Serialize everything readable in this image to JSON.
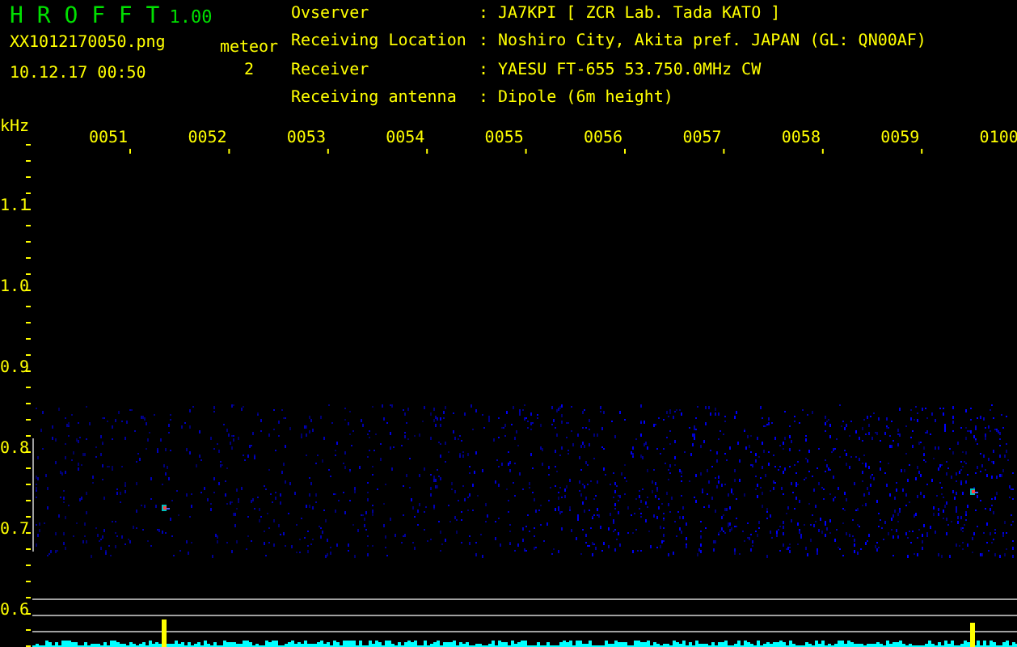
{
  "header": {
    "title": "H R O F F T",
    "version": "1.00",
    "filename": "XX1012170050.png",
    "datetime": "10.12.17 00:50",
    "meteor_label": "meteor",
    "meteor_count": "2"
  },
  "info": [
    {
      "label": "Ovserver",
      "value": ": JA7KPI [ ZCR Lab. Tada KATO ]"
    },
    {
      "label": "Receiving Location",
      "value": ": Noshiro City, Akita pref. JAPAN (GL: QN00AF)"
    },
    {
      "label": "Receiver",
      "value": ": YAESU FT-655 53.750.0MHz CW"
    },
    {
      "label": "Receiving antenna",
      "value": ": Dipole (6m height)"
    }
  ],
  "plot": {
    "y_unit": "kHz",
    "y_labels": [
      "1.1",
      "1.0",
      "0.9",
      "0.8",
      "0.7",
      "0.6"
    ],
    "time_labels": [
      "0051",
      "0052",
      "0053",
      "0054",
      "0055",
      "0056",
      "0057",
      "0058",
      "0059",
      "0100"
    ]
  }
}
